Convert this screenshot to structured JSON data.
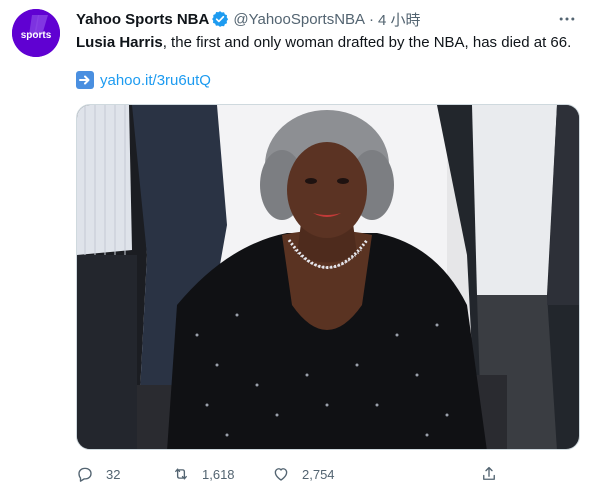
{
  "tweet": {
    "display_name": "Yahoo Sports NBA",
    "handle": "@YahooSportsNBA",
    "separator": "·",
    "time": "4 小時",
    "avatar_text": "sports",
    "text_bold": "Lusia Harris",
    "text_rest": ", the first and only woman drafted by the NBA, has died at 66.",
    "link": "yahoo.it/3ru6utQ",
    "counts": {
      "replies": "32",
      "retweets": "1,618",
      "likes": "2,754"
    }
  },
  "icons": {
    "verified": "verified-badge-icon",
    "more": "more-icon",
    "link_arrow": "right-arrow-emoji-icon",
    "reply": "reply-icon",
    "retweet": "retweet-icon",
    "like": "heart-icon",
    "share": "share-icon"
  },
  "colors": {
    "brand_purple": "#6001d2",
    "link_blue": "#1d9bf0",
    "secondary_text": "#536471"
  }
}
